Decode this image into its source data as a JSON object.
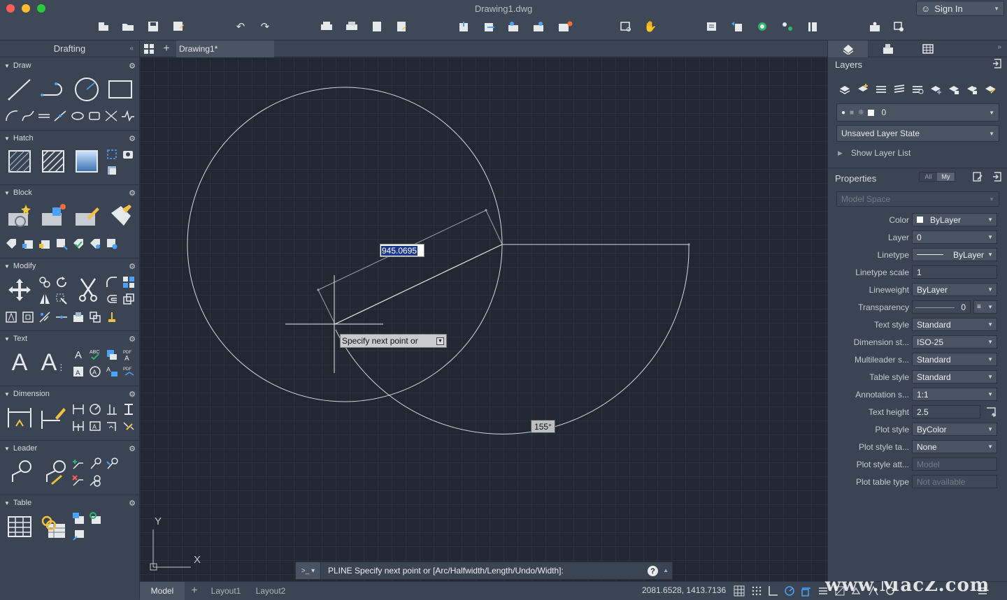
{
  "window": {
    "title": "Drawing1.dwg",
    "signin": "Sign In"
  },
  "colors": {
    "canvas_bg": "#212832",
    "panel_bg": "#3b4453",
    "accent_selection": "#1b3a8c",
    "close": "#ff5f57",
    "minimize": "#febc2e",
    "maximize": "#28c840"
  },
  "toolbar_icons": [
    "new-icon",
    "open-icon",
    "save-icon",
    "save-as-icon",
    "undo-icon",
    "redo-icon",
    "plot-icon",
    "batch-plot-icon",
    "page-setup-icon",
    "publish-icon",
    "import-icon",
    "export-icon",
    "attach-icon",
    "reference-manager-icon",
    "sheet-set-icon",
    "zoom-window-icon",
    "pan-icon",
    "layer-properties-icon",
    "layer-previous-icon",
    "layer-state-icon",
    "layer-walk-icon",
    "layer-match-icon",
    "named-views-icon",
    "view-manager-icon"
  ],
  "left_panel": {
    "title": "Drafting",
    "collapse": "«",
    "sections": [
      {
        "name": "Draw"
      },
      {
        "name": "Hatch"
      },
      {
        "name": "Block"
      },
      {
        "name": "Modify"
      },
      {
        "name": "Text"
      },
      {
        "name": "Dimension"
      },
      {
        "name": "Leader"
      },
      {
        "name": "Table"
      }
    ]
  },
  "doc_tab": {
    "label": "Drawing1*",
    "add": "+"
  },
  "canvas": {
    "dyn_value": "945.0695",
    "prompt": "Specify next point or",
    "angle": "155°",
    "ucs_y": "Y",
    "ucs_x": "X"
  },
  "command_line": {
    "prefix": ">_ ▾",
    "text": "PLINE Specify next point or [Arc/Halfwidth/Length/Undo/Width]:",
    "help": "?"
  },
  "status_bar": {
    "tabs": [
      "Model",
      "Layout1",
      "Layout2"
    ],
    "add": "+",
    "coords": "2081.6528, 1413.7136",
    "watermark": "www.MacZ.com"
  },
  "right_panel": {
    "expand": "»",
    "layers": {
      "title": "Layers",
      "current_layer": "0",
      "layer_state": "Unsaved Layer State",
      "show_list": "Show Layer List"
    },
    "properties": {
      "title": "Properties",
      "filter_all": "All",
      "filter_my": "My",
      "space": "Model Space",
      "rows": [
        {
          "label": "Color",
          "value": "ByLayer",
          "kind": "dropdown"
        },
        {
          "label": "Layer",
          "value": "0",
          "kind": "dropdown"
        },
        {
          "label": "Linetype",
          "value": "ByLayer",
          "kind": "dropdown"
        },
        {
          "label": "Linetype scale",
          "value": "1",
          "kind": "text"
        },
        {
          "label": "Lineweight",
          "value": "ByLayer",
          "kind": "dropdown"
        },
        {
          "label": "Transparency",
          "value": "0",
          "kind": "slider"
        },
        {
          "label": "Text style",
          "value": "Standard",
          "kind": "dropdown"
        },
        {
          "label": "Dimension st...",
          "value": "ISO-25",
          "kind": "dropdown"
        },
        {
          "label": "Multileader s...",
          "value": "Standard",
          "kind": "dropdown"
        },
        {
          "label": "Table style",
          "value": "Standard",
          "kind": "dropdown"
        },
        {
          "label": "Annotation s...",
          "value": "1:1",
          "kind": "dropdown"
        },
        {
          "label": "Text height",
          "value": "2.5",
          "kind": "text"
        },
        {
          "label": "Plot style",
          "value": "ByColor",
          "kind": "dropdown"
        },
        {
          "label": "Plot style ta...",
          "value": "None",
          "kind": "dropdown"
        },
        {
          "label": "Plot style att...",
          "value": "Model",
          "kind": "disabled"
        },
        {
          "label": "Plot table type",
          "value": "Not available",
          "kind": "disabled"
        }
      ]
    }
  }
}
